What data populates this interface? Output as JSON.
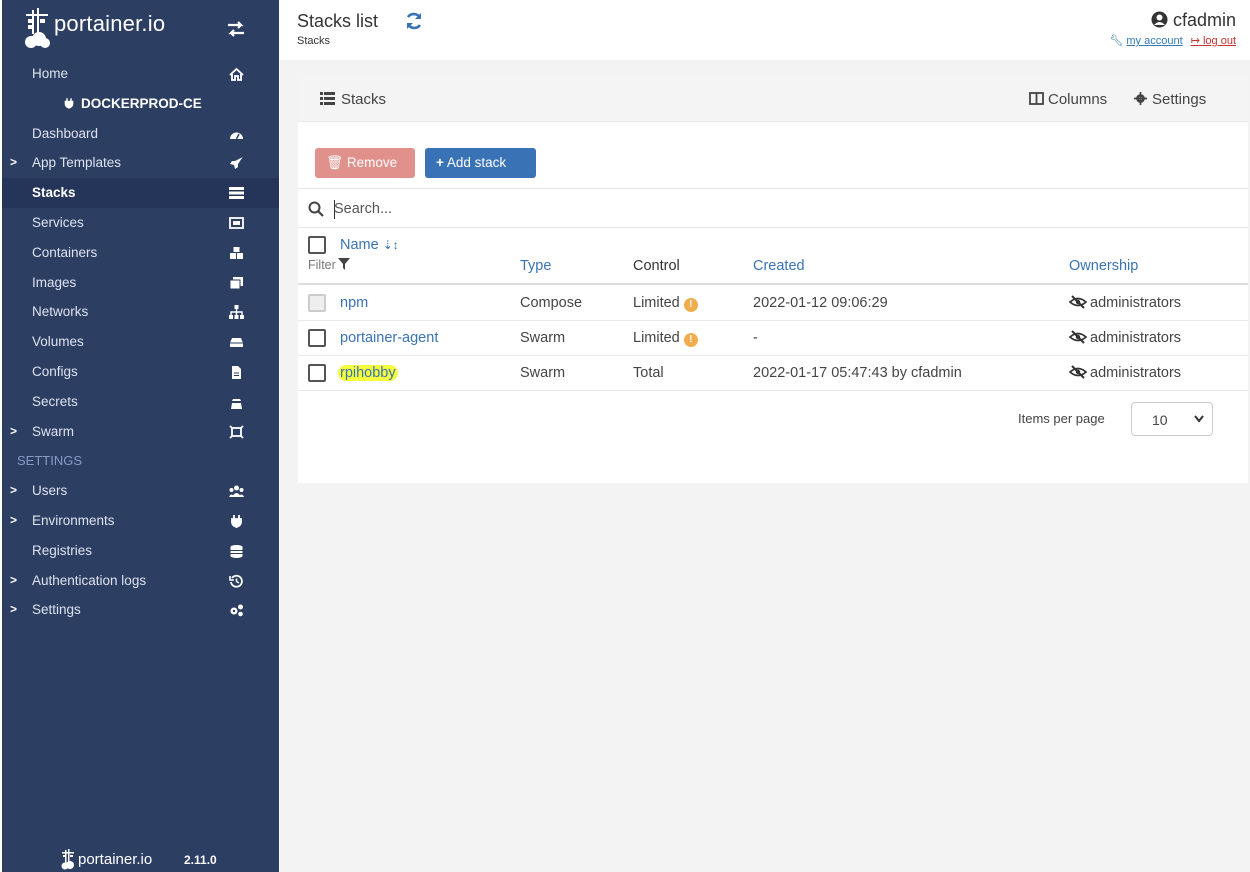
{
  "brand": {
    "name": "portainer.io"
  },
  "sidebar": {
    "items": [
      {
        "label": "Home",
        "icon": "home-icon",
        "chevron": "",
        "kind": "normal"
      },
      {
        "label": "DOCKERPROD-CE",
        "icon": "plug-icon",
        "chevron": "",
        "kind": "env"
      },
      {
        "label": "Dashboard",
        "icon": "dashboard-icon",
        "chevron": "",
        "kind": "normal"
      },
      {
        "label": "App Templates",
        "icon": "rocket-icon",
        "chevron": ">",
        "kind": "normal"
      },
      {
        "label": "Stacks",
        "icon": "list-icon",
        "chevron": "",
        "kind": "active"
      },
      {
        "label": "Services",
        "icon": "services-icon",
        "chevron": "",
        "kind": "normal"
      },
      {
        "label": "Containers",
        "icon": "cubes-icon",
        "chevron": "",
        "kind": "normal"
      },
      {
        "label": "Images",
        "icon": "clone-icon",
        "chevron": "",
        "kind": "normal"
      },
      {
        "label": "Networks",
        "icon": "sitemap-icon",
        "chevron": "",
        "kind": "normal"
      },
      {
        "label": "Volumes",
        "icon": "hdd-icon",
        "chevron": "",
        "kind": "normal"
      },
      {
        "label": "Configs",
        "icon": "file-icon",
        "chevron": "",
        "kind": "normal"
      },
      {
        "label": "Secrets",
        "icon": "user-secret-icon",
        "chevron": "",
        "kind": "normal"
      },
      {
        "label": "Swarm",
        "icon": "swarm-icon",
        "chevron": ">",
        "kind": "normal"
      },
      {
        "label": "SETTINGS",
        "icon": "",
        "chevron": "",
        "kind": "section"
      },
      {
        "label": "Users",
        "icon": "users-icon",
        "chevron": ">",
        "kind": "normal"
      },
      {
        "label": "Environments",
        "icon": "plug-icon",
        "chevron": ">",
        "kind": "normal"
      },
      {
        "label": "Registries",
        "icon": "database-icon",
        "chevron": "",
        "kind": "normal"
      },
      {
        "label": "Authentication logs",
        "icon": "history-icon",
        "chevron": ">",
        "kind": "normal"
      },
      {
        "label": "Settings",
        "icon": "cogs-icon",
        "chevron": ">",
        "kind": "normal"
      }
    ],
    "footer": {
      "brand": "portainer.io",
      "version": "2.11.0"
    }
  },
  "header": {
    "title": "Stacks list",
    "breadcrumb": "Stacks",
    "username": "cfadmin",
    "my_account": "my account",
    "logout": "log out"
  },
  "widget": {
    "title": "Stacks",
    "columns_label": "Columns",
    "settings_label": "Settings",
    "remove_label": "Remove",
    "add_label": "Add stack",
    "search_placeholder": "Search...",
    "headers": {
      "name": "Name",
      "filter": "Filter",
      "type": "Type",
      "control": "Control",
      "created": "Created",
      "ownership": "Ownership"
    },
    "rows": [
      {
        "name": "npm",
        "type": "Compose",
        "control": "Limited",
        "warn": true,
        "created": "2022-01-12 09:06:29",
        "ownership": "administrators",
        "checkbox_disabled": true,
        "highlighted": false
      },
      {
        "name": "portainer-agent",
        "type": "Swarm",
        "control": "Limited",
        "warn": true,
        "created": "-",
        "ownership": "administrators",
        "checkbox_disabled": false,
        "highlighted": false
      },
      {
        "name": "rpihobby",
        "type": "Swarm",
        "control": "Total",
        "warn": false,
        "created": "2022-01-17 05:47:43 by cfadmin",
        "ownership": "administrators",
        "checkbox_disabled": false,
        "highlighted": true
      }
    ],
    "items_per_page_label": "Items per page",
    "items_per_page_value": "10"
  },
  "colors": {
    "sidebar_bg": "#2d3e63",
    "accent": "#3a73b5",
    "remove": "#e0918c",
    "warning": "#f0ad4e",
    "highlight": "#f5ff3d"
  }
}
